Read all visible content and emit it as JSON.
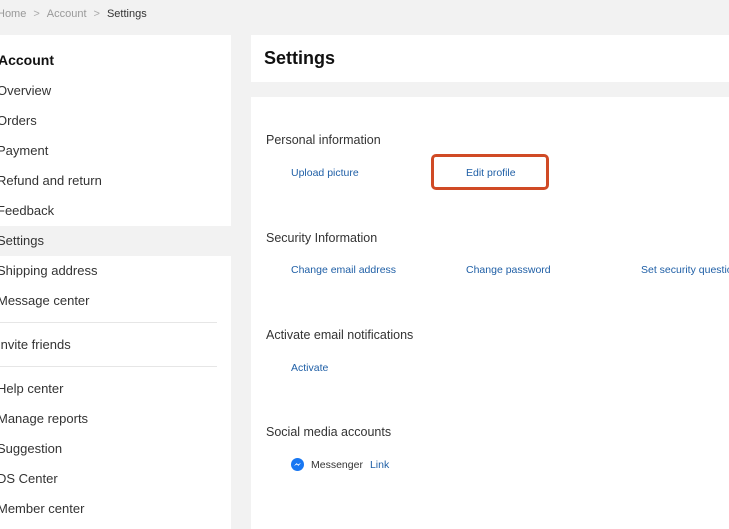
{
  "breadcrumb": {
    "home": "Home",
    "account": "Account",
    "current": "Settings",
    "separator": ">"
  },
  "sidebar": {
    "title": "Account",
    "items": [
      {
        "label": "Overview"
      },
      {
        "label": "Orders"
      },
      {
        "label": "Payment"
      },
      {
        "label": "Refund and return"
      },
      {
        "label": "Feedback"
      },
      {
        "label": "Settings",
        "active": true
      },
      {
        "label": "Shipping address"
      },
      {
        "label": "Message center"
      },
      {
        "label": "Invite friends"
      },
      {
        "label": "Help center"
      },
      {
        "label": "Manage reports"
      },
      {
        "label": "Suggestion"
      },
      {
        "label": "DS Center"
      },
      {
        "label": "Member center"
      }
    ]
  },
  "header": {
    "title": "Settings"
  },
  "sections": {
    "personal": {
      "title": "Personal information",
      "upload_picture": "Upload picture",
      "edit_profile": "Edit profile"
    },
    "security": {
      "title": "Security Information",
      "change_email": "Change email address",
      "change_password": "Change password",
      "set_security_question": "Set security question"
    },
    "notifications": {
      "title": "Activate email notifications",
      "activate": "Activate"
    },
    "social": {
      "title": "Social media accounts",
      "messenger_label": "Messenger",
      "messenger_link": "Link"
    }
  },
  "colors": {
    "link": "#1f5fa6",
    "highlight": "#d04a25",
    "messenger": "#1877f2"
  },
  "icons": {
    "messenger": "messenger-icon"
  }
}
